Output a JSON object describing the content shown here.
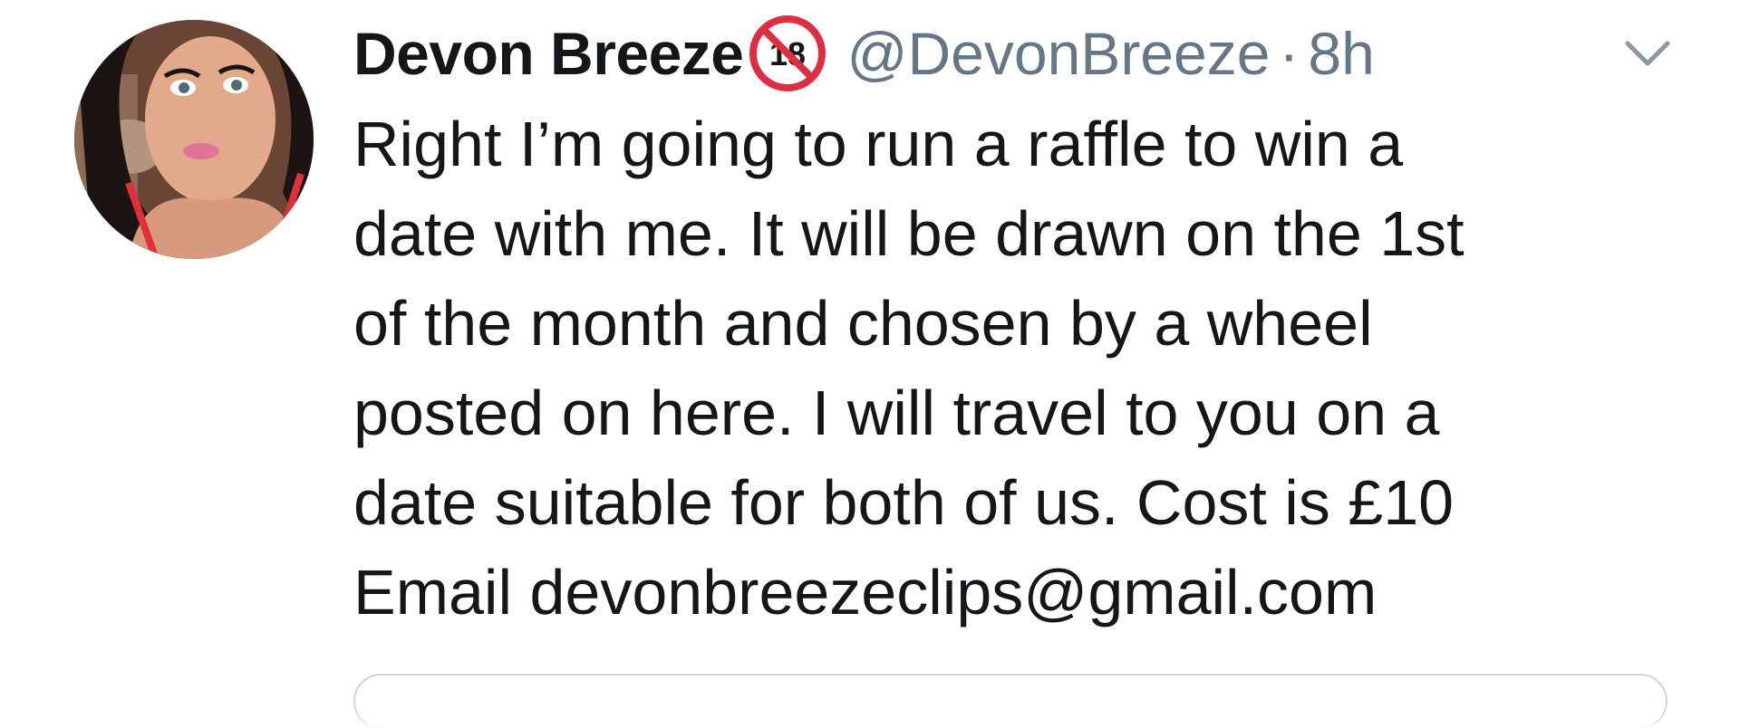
{
  "tweet": {
    "display_name": "Devon Breeze",
    "badge_label": "18",
    "badge_icon": "no-under-18-icon",
    "handle": "@DevonBreeze",
    "separator": "·",
    "time": "8h",
    "body": "Right I’m going to run a raffle to win a\ndate with me. It will be drawn on the 1st\nof the month and chosen by a wheel\nposted on here. I will travel to you on a\ndate suitable for both of us. Cost is £10\nEmail devonbreezeclips@gmail.com"
  },
  "colors": {
    "text_primary": "#14171a",
    "text_secondary": "#657786",
    "badge_red": "#dd2e44",
    "card_border": "#ccd6dd"
  }
}
